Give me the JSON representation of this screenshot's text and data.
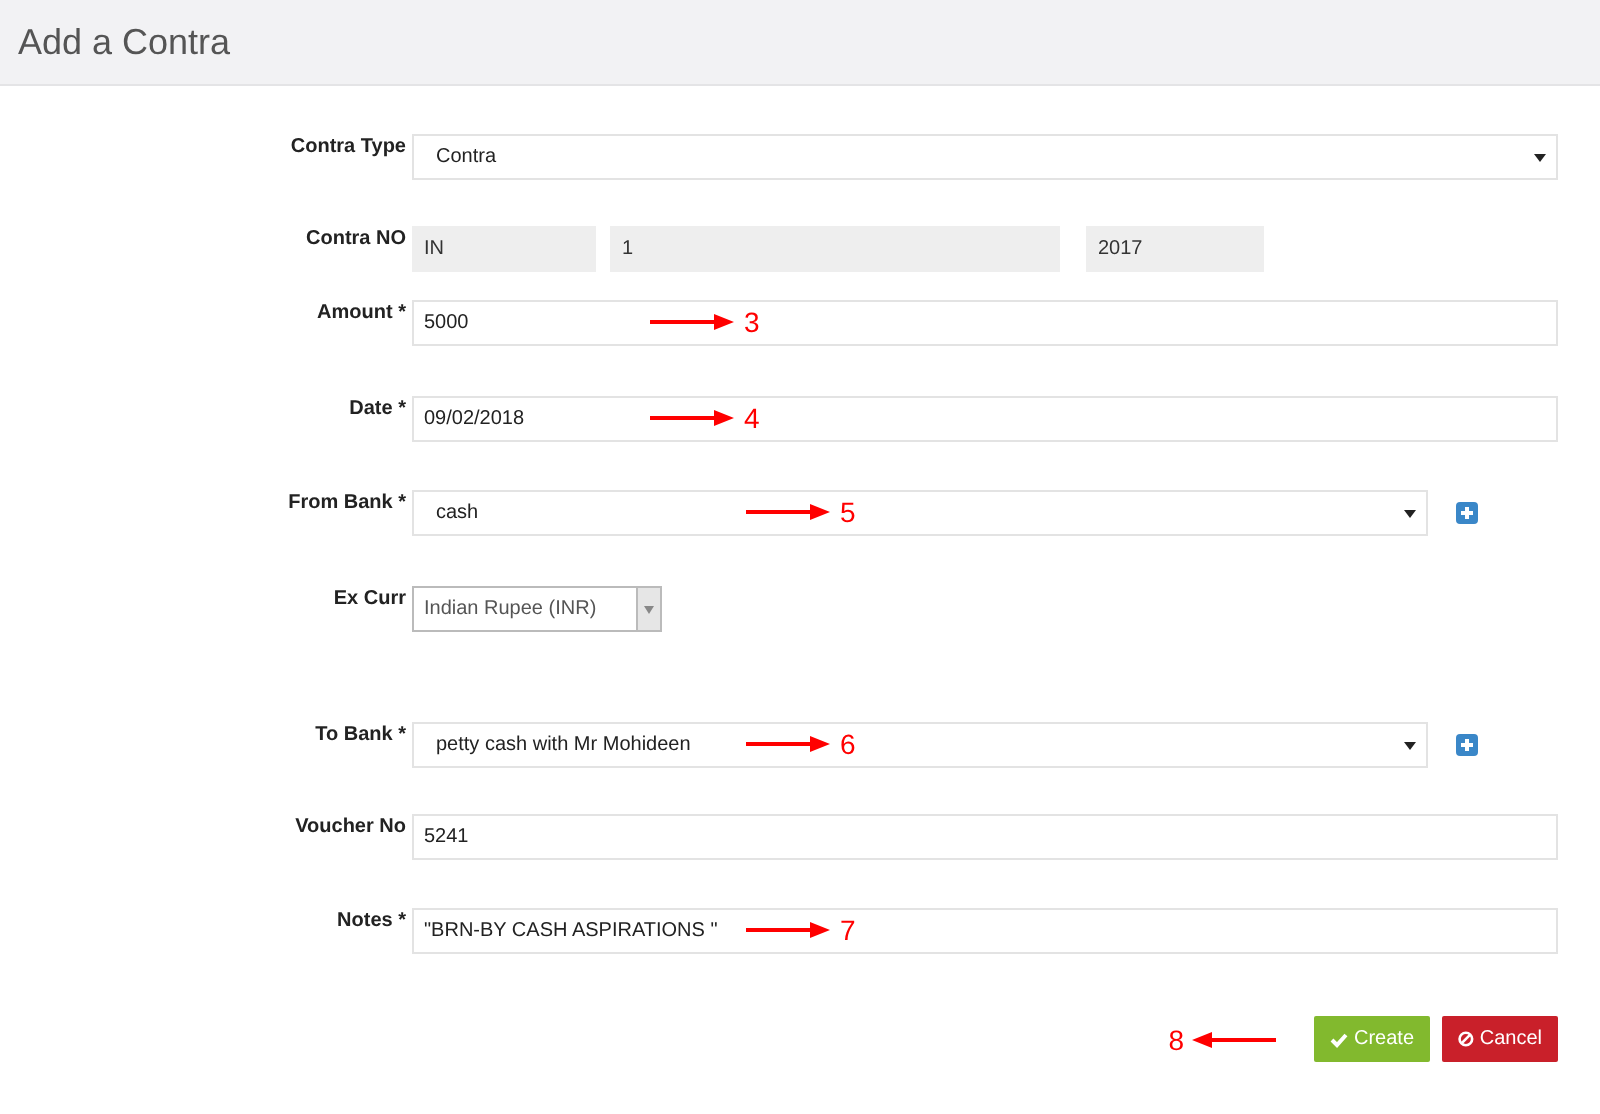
{
  "page_title": "Add a Contra",
  "fields": [
    {
      "kind": "select",
      "label": "Contra Type",
      "value": "Contra",
      "add_button": false
    },
    {
      "kind": "number_parts",
      "label": "Contra NO",
      "parts": [
        "IN",
        "1",
        "2017"
      ]
    },
    {
      "kind": "text",
      "label": "Amount *",
      "value": "5000",
      "annotation": "3"
    },
    {
      "kind": "text",
      "label": "Date *",
      "value": "09/02/2018",
      "annotation": "4"
    },
    {
      "kind": "select",
      "label": "From Bank *",
      "value": "cash",
      "add_button": true,
      "annotation": "5"
    },
    {
      "kind": "combo",
      "label": "Ex Curr",
      "value": "Indian Rupee (INR)"
    },
    {
      "kind": "select",
      "label": "To Bank *",
      "value": "petty cash with Mr Mohideen",
      "add_button": true,
      "annotation": "6"
    },
    {
      "kind": "text",
      "label": "Voucher No",
      "value": "5241"
    },
    {
      "kind": "text",
      "label": "Notes *",
      "value": "\"BRN-BY CASH ASPIRATIONS \"",
      "annotation": "7"
    }
  ],
  "actions": {
    "annotation": "8",
    "buttons": [
      {
        "kind": "create",
        "label": "Create"
      },
      {
        "kind": "cancel",
        "label": "Cancel"
      }
    ]
  }
}
